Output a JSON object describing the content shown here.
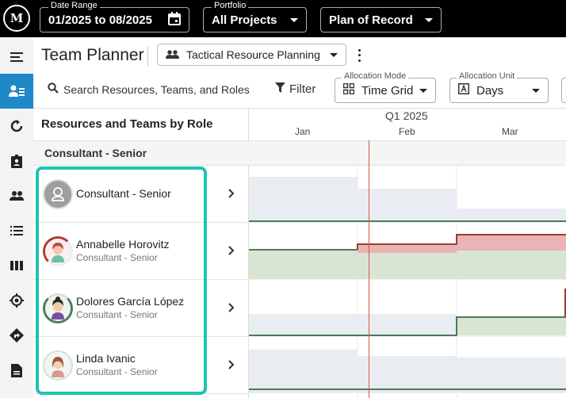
{
  "topbar": {
    "logo_text": "M",
    "date_range": {
      "label": "Date Range",
      "value": "01/2025 to 08/2025"
    },
    "portfolio": {
      "label": "Portfolio",
      "value": "All Projects"
    },
    "plan": {
      "value": "Plan of Record"
    }
  },
  "sidebar": {
    "items": [
      {
        "icon": "menu-icon"
      },
      {
        "icon": "team-planner-icon",
        "active": true
      },
      {
        "icon": "refresh-icon"
      },
      {
        "icon": "badge-icon"
      },
      {
        "icon": "people-icon"
      },
      {
        "icon": "list-icon"
      },
      {
        "icon": "columns-icon"
      },
      {
        "icon": "target-icon"
      },
      {
        "icon": "direction-icon"
      },
      {
        "icon": "document-icon"
      }
    ]
  },
  "header": {
    "title": "Team Planner",
    "view": "Tactical Resource Planning"
  },
  "toolbar": {
    "search_placeholder": "Search Resources, Teams, and Roles",
    "filter_label": "Filter",
    "allocation_mode": {
      "label": "Allocation Mode",
      "value": "Time Grid"
    },
    "allocation_unit": {
      "label": "Allocation Unit",
      "value": "Days"
    }
  },
  "grid": {
    "column_header": "Resources and Teams by Role",
    "quarter": "Q1 2025",
    "months": [
      "Jan",
      "Feb",
      "Mar"
    ],
    "group": "Consultant - Senior",
    "rows": [
      {
        "name": "Consultant - Senior",
        "subtitle": ""
      },
      {
        "name": "Annabelle Horovitz",
        "subtitle": "Consultant - Senior"
      },
      {
        "name": "Dolores García López",
        "subtitle": "Consultant - Senior"
      },
      {
        "name": "Linda Ivanic",
        "subtitle": "Consultant - Senior"
      }
    ]
  },
  "colors": {
    "accent": "#1e88c8",
    "highlight": "#1ec4b0",
    "over_allocation": "#e8b4b4",
    "under_allocation": "#d9e5d2",
    "capacity_line_over": "#a33a2e",
    "capacity_line_ok": "#4a7a5a",
    "today_line": "#d9534f"
  }
}
